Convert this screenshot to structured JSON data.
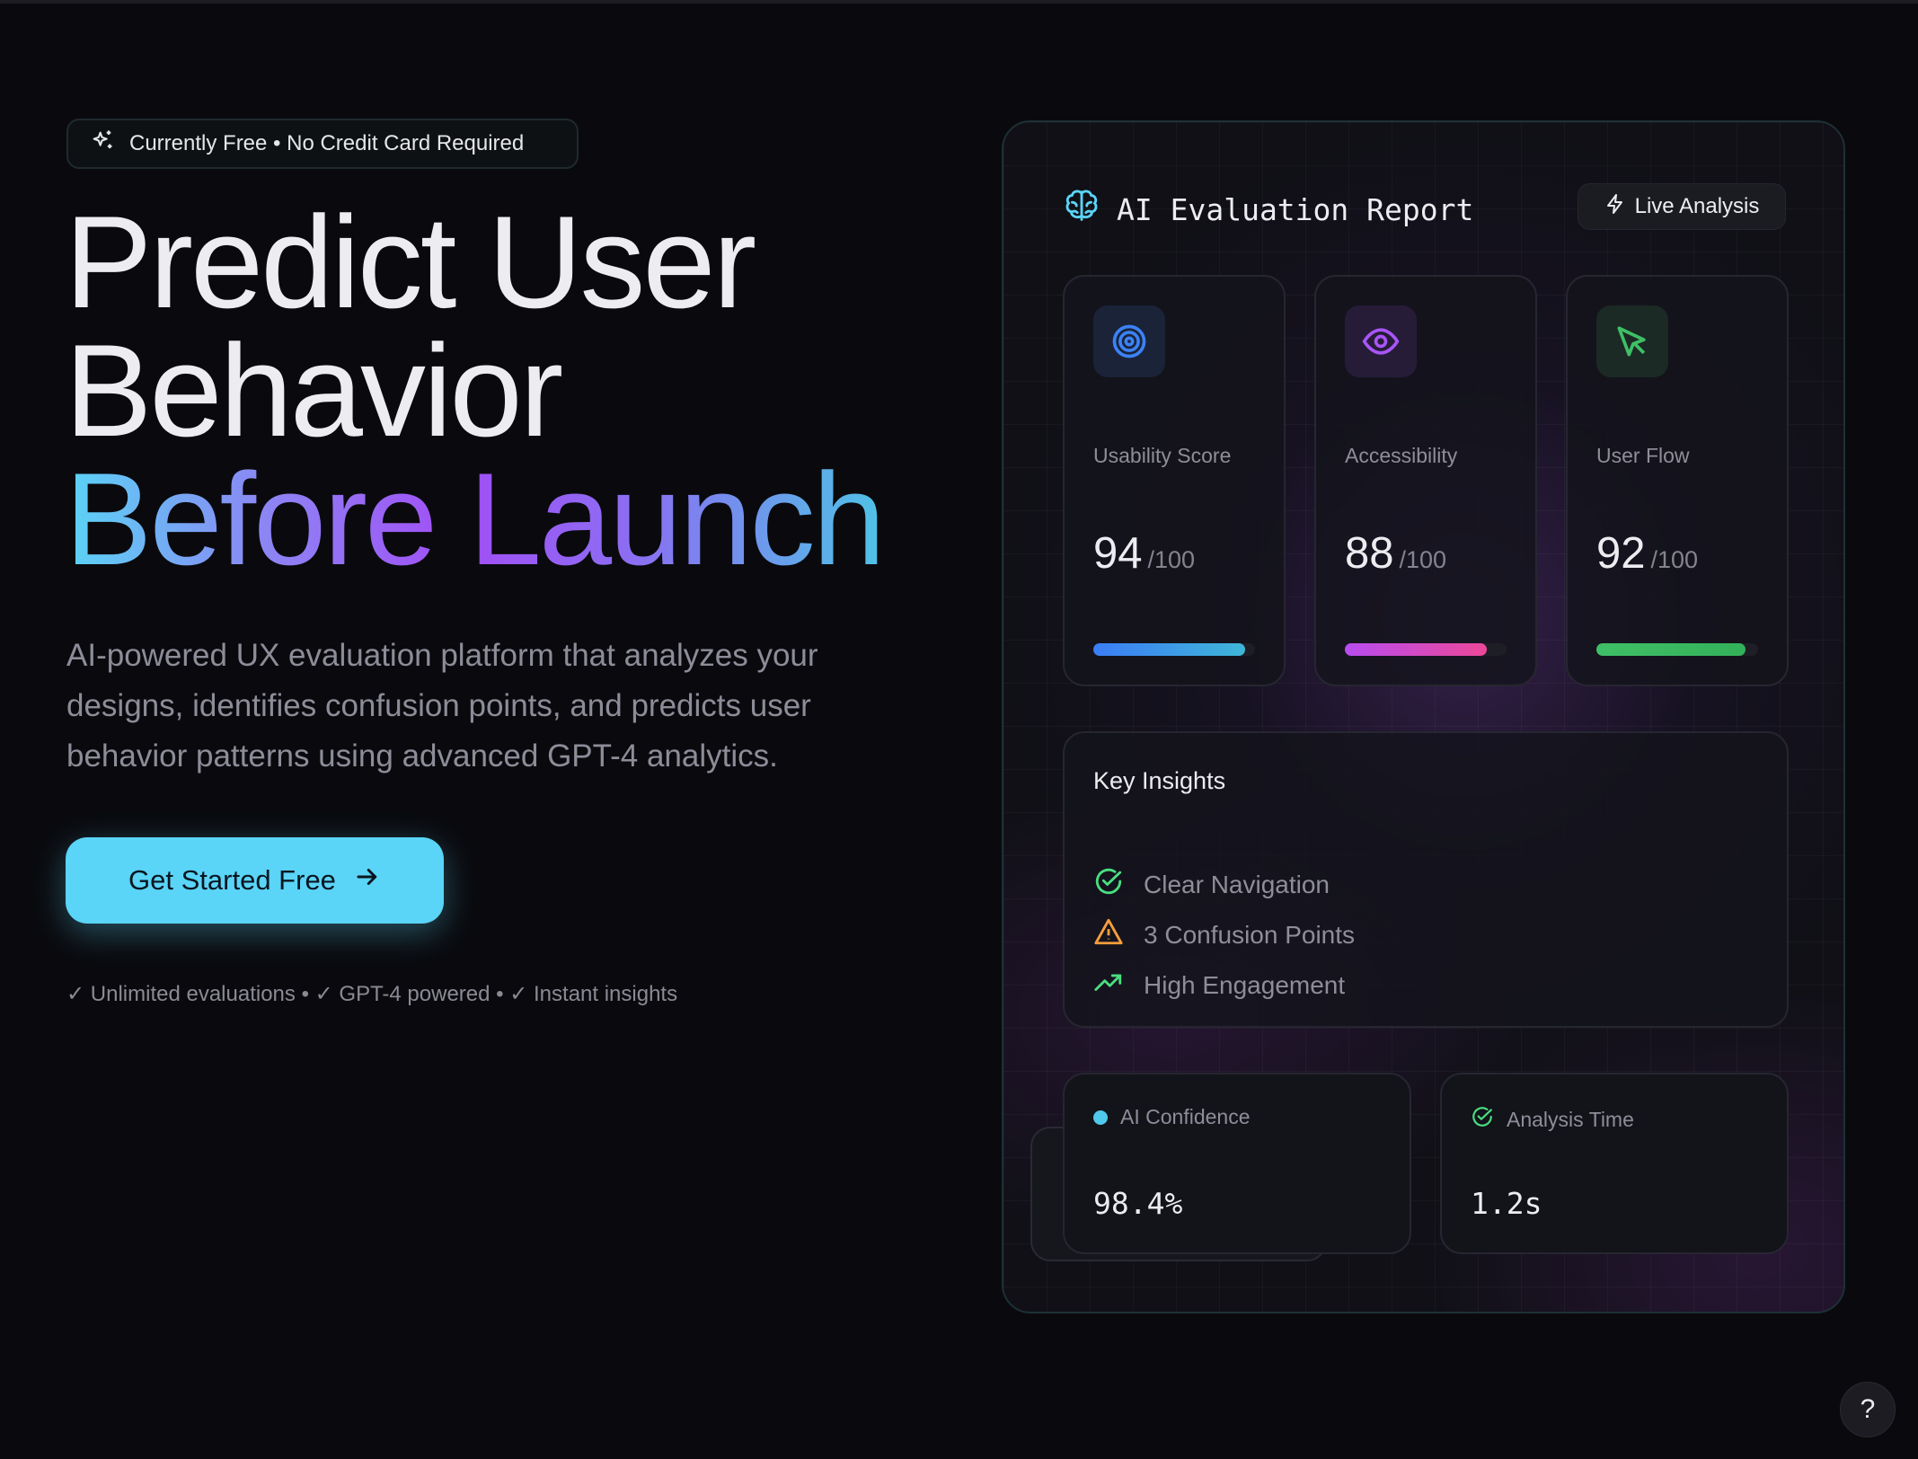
{
  "hero": {
    "badge_text": "Currently Free • No Credit Card Required",
    "headline_line1": "Predict User",
    "headline_line2": "Behavior",
    "headline_line3": "Before Launch",
    "description": "AI-powered UX evaluation platform that analyzes your designs, identifies confusion points, and predicts user behavior patterns using advanced GPT-4 analytics.",
    "cta_label": "Get Started Free",
    "perks": "✓ Unlimited evaluations • ✓ GPT-4 powered • ✓ Instant insights"
  },
  "report": {
    "title": "AI Evaluation Report",
    "live_label": "Live Analysis",
    "metrics": [
      {
        "label": "Usability Score",
        "value": "94",
        "max": "/100",
        "progress": 0.94,
        "icon": "target-icon"
      },
      {
        "label": "Accessibility",
        "value": "88",
        "max": "/100",
        "progress": 0.88,
        "icon": "eye-icon"
      },
      {
        "label": "User Flow",
        "value": "92",
        "max": "/100",
        "progress": 0.92,
        "icon": "cursor-icon"
      }
    ],
    "insights": {
      "title": "Key Insights",
      "items": [
        {
          "label": "Clear Navigation",
          "icon": "check-circle-icon"
        },
        {
          "label": "3 Confusion Points",
          "icon": "warning-icon"
        },
        {
          "label": "High Engagement",
          "icon": "trending-up-icon"
        }
      ]
    },
    "stats": [
      {
        "label": "AI Confidence",
        "value": "98.4%"
      },
      {
        "label": "Analysis Time",
        "value": "1.2s"
      }
    ]
  },
  "help_label": "?",
  "colors": {
    "accent": "#5ad4f7",
    "usability_bar": "#3b82f6",
    "accessibility_bar": "#c04ce8",
    "userflow_bar": "#3fbf66",
    "success": "#4ade80",
    "warning": "#f59e3b"
  }
}
